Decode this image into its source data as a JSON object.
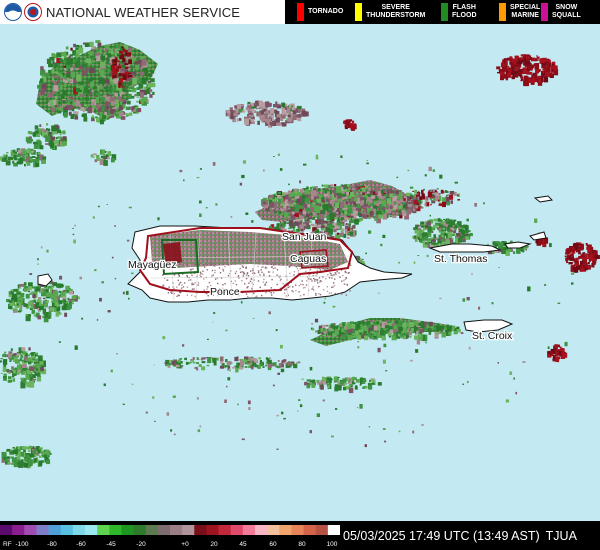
{
  "header": {
    "agency_title": "NATIONAL WEATHER SERVICE",
    "logo_left": "noaa-logo",
    "logo_right": "nws-logo"
  },
  "warnings_legend": [
    {
      "label_line1": "TORNADO",
      "label_line2": "",
      "color": "#ff0000"
    },
    {
      "label_line1": "SEVERE",
      "label_line2": "THUNDERSTORM",
      "color": "#ffff00"
    },
    {
      "label_line1": "FLASH",
      "label_line2": "FLOOD",
      "color": "#228b22"
    },
    {
      "label_line1": "SPECIAL",
      "label_line2": "MARINE",
      "color": "#ff9900"
    },
    {
      "label_line1": "SNOW",
      "label_line2": "SQUALL",
      "color": "#cc1199"
    }
  ],
  "map": {
    "places": [
      {
        "name": "San Juan"
      },
      {
        "name": "Mayagüez"
      },
      {
        "name": "Caguas"
      },
      {
        "name": "Ponce"
      },
      {
        "name": "St. Thomas"
      },
      {
        "name": "St. Croix"
      }
    ]
  },
  "scale": {
    "prefix": "RF",
    "ticks": [
      "-100",
      "-80",
      "-60",
      "-45",
      "-20",
      "+0",
      "20",
      "45",
      "60",
      "80",
      "100"
    ]
  },
  "footer": {
    "timestamp": "05/03/2025 17:49 UTC (13:49 AST)",
    "site": "TJUA"
  }
}
